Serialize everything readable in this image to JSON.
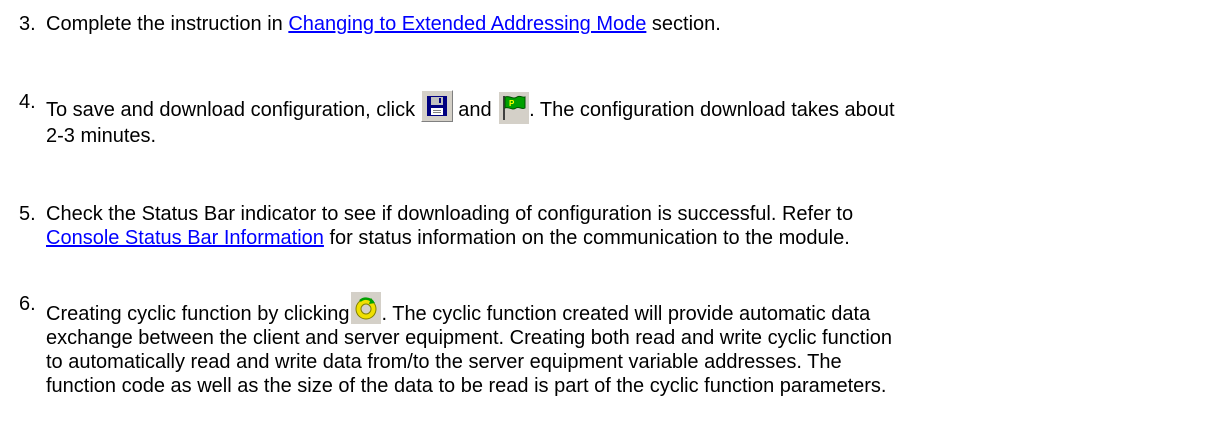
{
  "steps": [
    {
      "number": "3.",
      "before": "Complete the instruction in ",
      "link": "Changing to Extended Addressing Mode",
      "after": " section."
    },
    {
      "number": "4.",
      "before": "To save and download configuration, click ",
      "middle": " and ",
      "after_line1": ". The configuration download takes about",
      "line2": "2-3 minutes.",
      "icons": [
        "save-icon",
        "download-flag-icon"
      ]
    },
    {
      "number": "5.",
      "line1": "Check the Status Bar indicator to see if downloading of configuration is successful. Refer to",
      "link": "Console Status Bar Information",
      "after_link": " for status information on the communication to the module."
    },
    {
      "number": "6.",
      "before": "Creating cyclic function by clicking",
      "after_line1": ". The cyclic function created will provide automatic data",
      "line2": "exchange between the client and server equipment. Creating both read and write cyclic function",
      "line3": "to automatically read and write data from/to the server equipment variable addresses. The",
      "line4": "function code as well as the size of the data to be read is part of the cyclic function parameters.",
      "icons": [
        "cyclic-function-icon"
      ]
    }
  ],
  "colors": {
    "link": "#0000ff",
    "text": "#000000",
    "button_face": "#d4d0c8"
  }
}
